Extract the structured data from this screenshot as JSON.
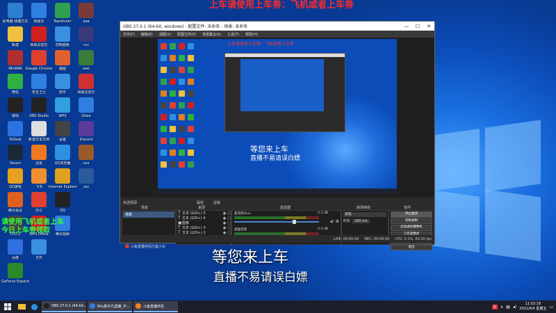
{
  "banner": "上车请使用上车劵：飞机或者上车劵",
  "overlay": {
    "green_line1": "请使用飞机或者上车",
    "green_line2": "今日上车劵领取",
    "main_text": "等您来上车",
    "sub_text": "直播不易请误白嫖"
  },
  "desktop_icons_left": [
    {
      "label": "此电脑-快捷方式",
      "color": "#2f7fd0"
    },
    {
      "label": "新建",
      "color": "#f0c040"
    },
    {
      "label": "WinRAR",
      "color": "#b03030"
    },
    {
      "label": "微信",
      "color": "#2fb040"
    },
    {
      "label": "游戏",
      "color": "#222"
    },
    {
      "label": "ToDesk",
      "color": "#2a72e0"
    },
    {
      "label": "Steam",
      "color": "#1b2838"
    },
    {
      "label": "QQ游戏",
      "color": "#e8a020"
    },
    {
      "label": "腾讯会议",
      "color": "#e06020"
    },
    {
      "label": "CPU-Z",
      "color": "#444"
    },
    {
      "label": "百度",
      "color": "#2f6fe0"
    },
    {
      "label": "GeForce Experience",
      "color": "#2a8a2a"
    },
    {
      "label": "网易云",
      "color": "#2f7fe0"
    },
    {
      "label": "网易云音乐",
      "color": "#d02020"
    },
    {
      "label": "Google Chrome",
      "color": "#e04030"
    },
    {
      "label": "安全卫士",
      "color": "#2f7fe0"
    },
    {
      "label": "OBS Studio",
      "color": "#222"
    },
    {
      "label": "新建文本文档",
      "color": "#ddd"
    },
    {
      "label": "迅雷",
      "color": "#f07820"
    },
    {
      "label": "飞书",
      "color": "#f09030"
    },
    {
      "label": "办公",
      "color": "#e04030"
    },
    {
      "label": "WPS Office",
      "color": "#d02020"
    },
    {
      "label": "文件",
      "color": "#3a8fe0"
    },
    {
      "label": "Bandicam",
      "color": "#30a050"
    },
    {
      "label": "控制面板",
      "color": "#3a8fe0"
    },
    {
      "label": "画图",
      "color": "#e06030"
    },
    {
      "label": "软件",
      "color": "#3a8fe0"
    },
    {
      "label": "WPS",
      "color": "#30a0e0"
    },
    {
      "label": "设置",
      "color": "#444"
    },
    {
      "label": "QQ浏览器",
      "color": "#2f8fe0"
    },
    {
      "label": "Internet Explorer",
      "color": "#e0a020"
    },
    {
      "label": "QQ",
      "color": "#222"
    },
    {
      "label": "腾讯视频",
      "color": "#2f7fe0"
    }
  ],
  "desktop_icons_right": [
    {
      "label": "aaa",
      "color": "#7a3a3a"
    },
    {
      "label": "ccc",
      "color": "#3a3a7a"
    },
    {
      "label": "eee",
      "color": "#3a7a3a"
    },
    {
      "label": "网易云音乐",
      "color": "#d03030"
    },
    {
      "label": "Gitee",
      "color": "#2f7fe0"
    },
    {
      "label": "Discord",
      "color": "#5a3a9a"
    },
    {
      "label": "xxx",
      "color": "#9a5a2a"
    },
    {
      "label": "zzz",
      "color": "#2a5a9a"
    }
  ],
  "obs": {
    "title": "OBS 27.0.1 (64-bit, windows) - 配置文件: 未命名 - 场景: 未命名",
    "menus": [
      "文件(F)",
      "编辑(E)",
      "视图(V)",
      "配置文件(P)",
      "场景集合(S)",
      "工具(T)",
      "帮助(H)"
    ],
    "preview_banner": "上车请使用上车劵：飞机或者上车劵",
    "preview_main": "等您来上车",
    "preview_sub": "直播不易请误白嫖",
    "source_toolbar": [
      "未选择源",
      "属性",
      "滤镜"
    ],
    "docks": {
      "scenes_title": "场景",
      "sources_title": "来源",
      "mixer_title": "混音器",
      "transitions_title": "转场特效",
      "controls_title": "控件"
    },
    "scenes": [
      "场景"
    ],
    "sources": [
      {
        "icon": "T",
        "name": "文本 (GDI+) 5"
      },
      {
        "icon": "T",
        "name": "文本 (GDI+) 4"
      },
      {
        "icon": "▣",
        "name": "图像"
      },
      {
        "icon": "T",
        "name": "文本 (GDI+) 3"
      },
      {
        "icon": "T",
        "name": "文本 (GDI+) 2"
      },
      {
        "icon": "T",
        "name": "文本 (GDI+)"
      }
    ],
    "mixer": [
      {
        "name": "麦克风/Aux",
        "db": "-1.2 dB",
        "level": 0.72
      },
      {
        "name": "桌面音频",
        "db": "-1.2 dB",
        "level": 0.62
      }
    ],
    "transition": {
      "type": "淡化",
      "duration_label": "时长",
      "duration": "300 ms"
    },
    "controls": [
      "停止推流",
      "开始录制",
      "启动虚拟摄像机",
      "工作室模式",
      "设置",
      "退出"
    ],
    "status": [
      "LIVE: 00:00:00",
      "REC: 00:00:00",
      "CPU: 0.1%, 60.00 fps"
    ]
  },
  "notification": "斗鱼直播伴侣已最小化",
  "taskbar": {
    "apps": [
      {
        "label": "OBS 27.0.1 (64-bit...",
        "color": "#222"
      },
      {
        "label": "Bilu影中凡直播_中...",
        "color": "#2f7fe0"
      },
      {
        "label": "斗鱼直播伴侣",
        "color": "#f08020"
      }
    ],
    "time": "11:53:18",
    "date": "2021/6/4 星期五"
  }
}
